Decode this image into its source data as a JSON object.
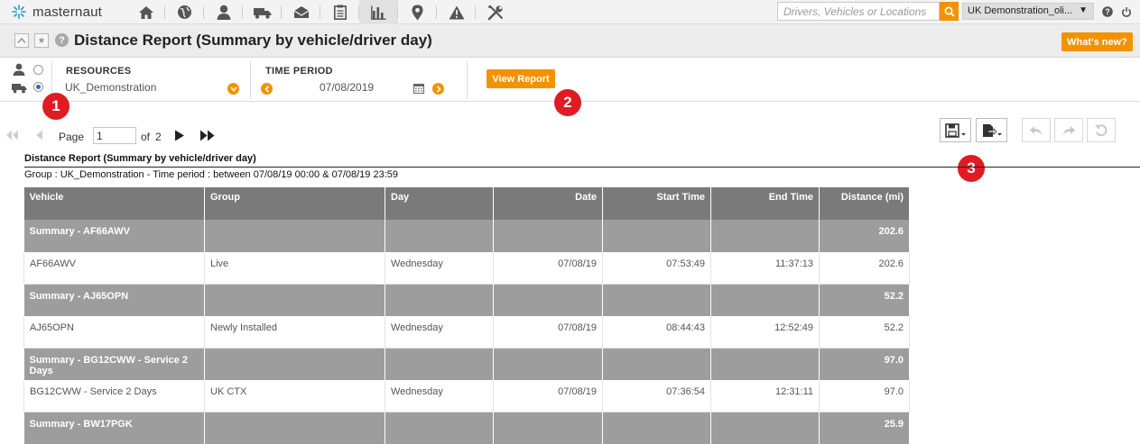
{
  "brand": {
    "name": "masternaut",
    "accent": "#f39200",
    "callout_color": "#e11b22"
  },
  "nav": {
    "icons": [
      "home-icon",
      "globe-icon",
      "person-icon",
      "truck-icon",
      "envelope-icon",
      "clipboard-icon",
      "bar-chart-icon",
      "location-pin-icon",
      "warning-icon",
      "tools-icon"
    ],
    "active": "bar-chart-icon",
    "search_placeholder": "Drivers, Vehicles or Locations",
    "account": "UK Demonstration_oli..."
  },
  "titlebar": {
    "title": "Distance Report (Summary by vehicle/driver day)",
    "whats_new": "What's new?"
  },
  "filters": {
    "resources_label": "RESOURCES",
    "resources_value": "UK_Demonstration",
    "time_period_label": "TIME PERIOD",
    "date": "07/08/2019",
    "view_report": "View Report"
  },
  "callouts": [
    "1",
    "2",
    "3"
  ],
  "pager": {
    "page_label": "Page",
    "page_value": "1",
    "of_label": "of",
    "total_pages": "2"
  },
  "report": {
    "title": "Distance Report (Summary by vehicle/driver day)",
    "subtitle": "Group : UK_Demonstration - Time period : between 07/08/19 00:00 & 07/08/19 23:59",
    "columns": [
      "Vehicle",
      "Group",
      "Day",
      "Date",
      "Start Time",
      "End Time",
      "Distance (mi)"
    ],
    "rows": [
      {
        "type": "summary",
        "cells": [
          "Summary - AF66AWV",
          "",
          "",
          "",
          "",
          "",
          "202.6"
        ]
      },
      {
        "type": "detail",
        "cells": [
          "AF66AWV",
          "Live",
          "Wednesday",
          "07/08/19",
          "07:53:49",
          "11:37:13",
          "202.6"
        ]
      },
      {
        "type": "summary",
        "cells": [
          "Summary - AJ65OPN",
          "",
          "",
          "",
          "",
          "",
          "52.2"
        ]
      },
      {
        "type": "detail",
        "cells": [
          "AJ65OPN",
          "Newly Installed",
          "Wednesday",
          "07/08/19",
          "08:44:43",
          "12:52:49",
          "52.2"
        ]
      },
      {
        "type": "summary",
        "cells": [
          "Summary - BG12CWW - Service 2 Days",
          "",
          "",
          "",
          "",
          "",
          "97.0"
        ]
      },
      {
        "type": "detail",
        "cells": [
          "BG12CWW - Service 2 Days",
          "UK CTX",
          "Wednesday",
          "07/08/19",
          "07:36:54",
          "12:31:11",
          "97.0"
        ]
      },
      {
        "type": "summary",
        "cells": [
          "Summary - BW17PGK",
          "",
          "",
          "",
          "",
          "",
          "25.9"
        ]
      }
    ]
  }
}
